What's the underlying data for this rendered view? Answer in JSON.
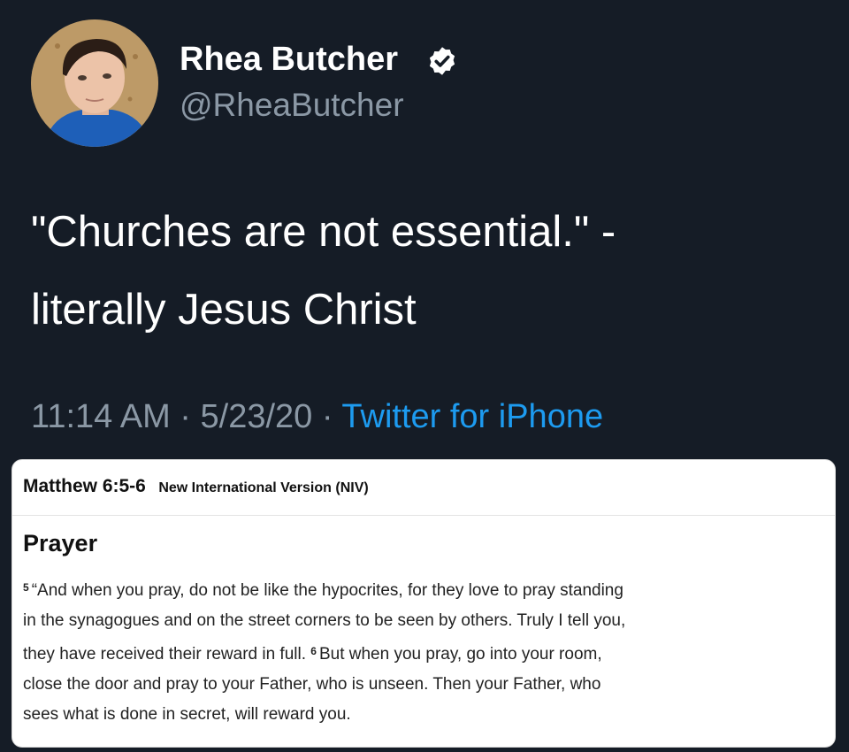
{
  "tweet": {
    "display_name": "Rhea Butcher",
    "handle": "@RheaButcher",
    "verified_icon": "verified-badge-icon",
    "text_lines": [
      "\"Churches are not essential.\" -",
      "literally Jesus Christ"
    ],
    "time": "11:14 AM",
    "date": "5/23/20",
    "source": "Twitter for iPhone",
    "separator": "·",
    "colors": {
      "background": "#151c26",
      "text": "#ffffff",
      "muted": "#8b98a5",
      "link": "#1d9bf0"
    }
  },
  "bible_card": {
    "reference": "Matthew 6:5-6",
    "version": "New International Version (NIV)",
    "heading": "Prayer",
    "verse_numbers": [
      "5",
      "6"
    ],
    "lines": [
      "“And when you pray, do not be like the hypocrites, for they love to pray standing",
      "in the synagogues and on the street corners to be seen by others. Truly I tell you,",
      "they have received their reward in full.",
      "But when you pray, go into your room,",
      "close the door and pray to your Father, who is unseen. Then your Father, who",
      "sees what is done in secret, will reward you."
    ]
  }
}
